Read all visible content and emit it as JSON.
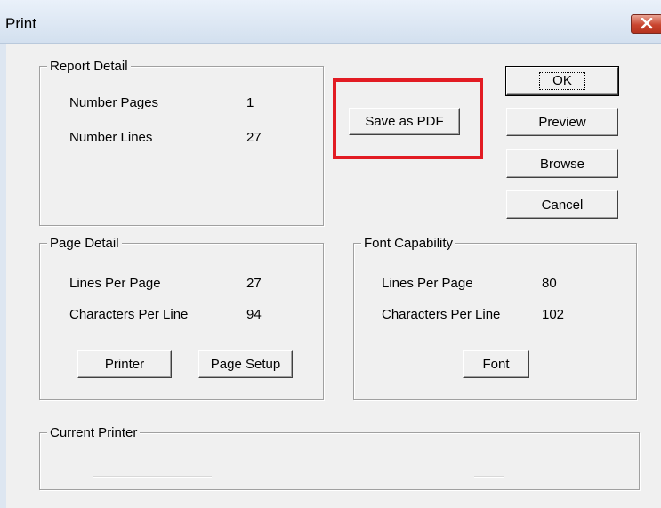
{
  "window": {
    "title": "Print"
  },
  "report_detail": {
    "legend": "Report Detail",
    "rows": [
      {
        "label": "Number Pages",
        "value": "1"
      },
      {
        "label": "Number Lines",
        "value": "27"
      }
    ]
  },
  "page_detail": {
    "legend": "Page Detail",
    "rows": [
      {
        "label": "Lines Per Page",
        "value": "27"
      },
      {
        "label": "Characters Per Line",
        "value": "94"
      }
    ],
    "printer_button": "Printer",
    "page_setup_button": "Page Setup"
  },
  "font_capability": {
    "legend": "Font Capability",
    "rows": [
      {
        "label": "Lines Per Page",
        "value": "80"
      },
      {
        "label": "Characters Per Line",
        "value": "102"
      }
    ],
    "font_button": "Font"
  },
  "current_printer": {
    "legend": "Current Printer"
  },
  "buttons": {
    "save_pdf": "Save as PDF",
    "ok": "OK",
    "preview": "Preview",
    "browse": "Browse",
    "cancel": "Cancel"
  },
  "colors": {
    "highlight": "#e21b23",
    "close_button": "#c9452f"
  },
  "icons": {
    "close": "close-icon"
  }
}
